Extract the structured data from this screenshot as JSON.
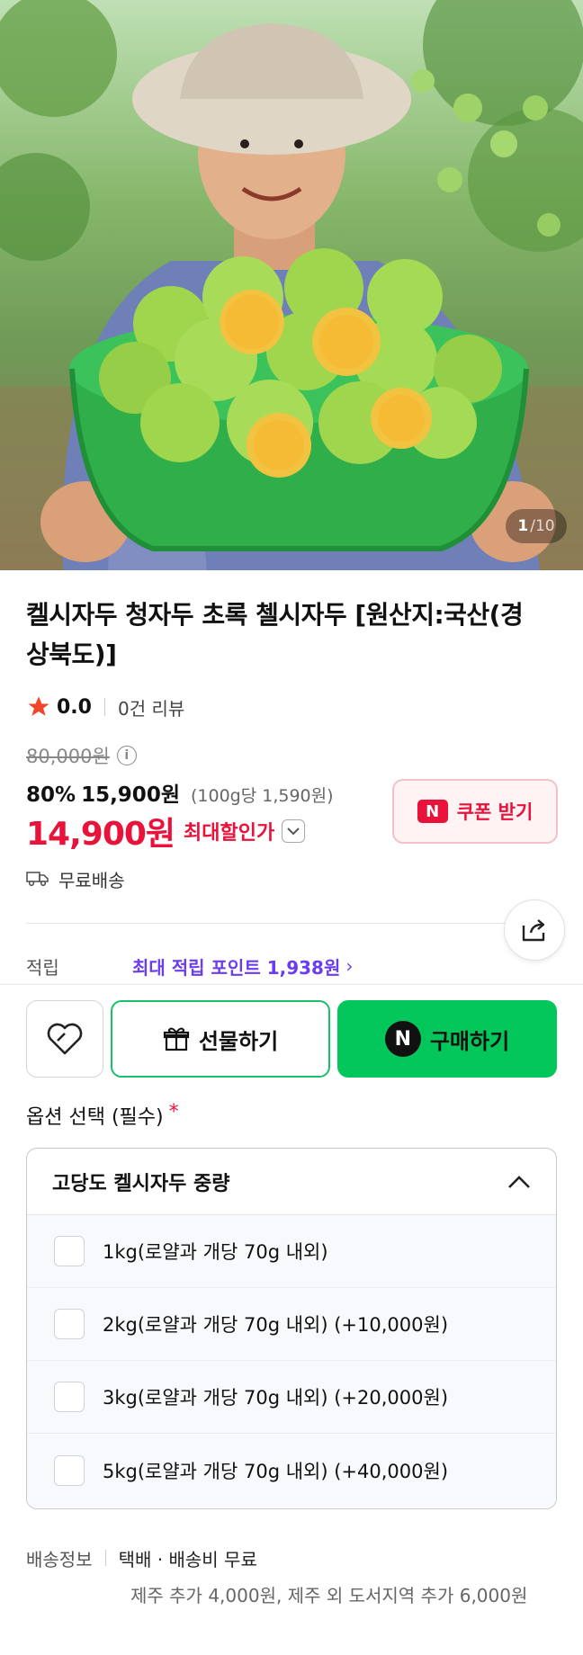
{
  "hero": {
    "counter_current": "1",
    "counter_total": "/10"
  },
  "product": {
    "title": "켈시자두 청자두 초록 첼시자두 [원산지:국산(경상북도)]",
    "rating": "0.0",
    "review_count": "0건 리뷰",
    "original_price": "80,000원",
    "discount_percent": "80%",
    "sale_price": "15,900원",
    "unit_price": "(100g당 1,590원)",
    "max_discount_price": "14,900원",
    "max_discount_label": "최대할인가",
    "shipping": "무료배송"
  },
  "coupon": {
    "badge": "N",
    "label": "쿠폰 받기"
  },
  "points": {
    "label": "적립",
    "value": "최대 적립 포인트 1,938원",
    "chevron": "›"
  },
  "actions": {
    "gift_label": "선물하기",
    "buy_badge": "N",
    "buy_label": "구매하기"
  },
  "options": {
    "title": "옵션 선택 (필수)",
    "required_mark": "*",
    "dropdown_label": "고당도 켈시자두 중량",
    "items": [
      {
        "label": "1kg(로얄과 개당 70g 내외)"
      },
      {
        "label": "2kg(로얄과 개당 70g 내외) (+10,000원)"
      },
      {
        "label": "3kg(로얄과 개당 70g 내외) (+20,000원)"
      },
      {
        "label": "5kg(로얄과 개당 70g 내외) (+40,000원)"
      }
    ]
  },
  "delivery": {
    "label": "배송정보",
    "value": "택배 · 배송비 무료",
    "extra": "제주 추가 4,000원, 제주 외 도서지역 추가 6,000원"
  },
  "colors": {
    "accent_red": "#e8123a",
    "naver_green": "#03c75a",
    "point_purple": "#6b3df0"
  },
  "icons": [
    "star-icon",
    "info-icon",
    "chevron-down-icon",
    "truck-icon",
    "share-icon",
    "heart-icon",
    "gift-icon",
    "chevron-up-icon"
  ]
}
